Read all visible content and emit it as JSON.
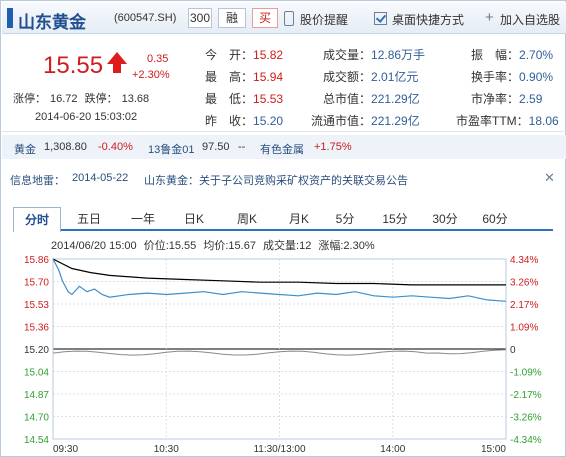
{
  "header": {
    "stock_name": "山东黄金",
    "stock_code": "(600547.SH)",
    "btn_300": "300",
    "btn_rong": "融",
    "btn_mai": "买",
    "price_alert": "股价提醒",
    "desktop_shortcut": "桌面快捷方式",
    "add_watchlist": "加入自选股",
    "plus_glyph": "+"
  },
  "quote": {
    "price": "15.55",
    "change": "0.35",
    "change_pct": "+2.30%",
    "limit_up_label": "涨停：",
    "limit_up": "16.72",
    "limit_down_label": "跌停：",
    "limit_down": "13.68",
    "time": "2014-06-20 15:03:02",
    "fields": [
      {
        "label": "今　开：",
        "value": "15.82",
        "color": "red"
      },
      {
        "label": "最　高：",
        "value": "15.94",
        "color": "red"
      },
      {
        "label": "最　低：",
        "value": "15.53",
        "color": "red"
      },
      {
        "label": "昨　收：",
        "value": "15.20",
        "color": "blue"
      },
      {
        "label": "成交量：",
        "value": "12.86万手",
        "color": "blue"
      },
      {
        "label": "成交额：",
        "value": "2.01亿元",
        "color": "blue"
      },
      {
        "label": "总市值：",
        "value": "221.29亿",
        "color": "blue"
      },
      {
        "label": "流通市值：",
        "value": "221.29亿",
        "color": "blue"
      },
      {
        "label": "振　幅：",
        "value": "2.70%",
        "color": "blue"
      },
      {
        "label": "换手率：",
        "value": "0.90%",
        "color": "blue"
      },
      {
        "label": "市净率：",
        "value": "2.59",
        "color": "blue"
      },
      {
        "label": "市盈率TTM：",
        "value": "18.06",
        "color": "blue"
      }
    ]
  },
  "sector": {
    "gold_label": "黄金",
    "gold_price": "1,308.80",
    "gold_change": "-0.40%",
    "futures_label": "13鲁金01",
    "futures_price": "97.50",
    "futures_change": "--",
    "metal_label": "有色金属",
    "metal_change": "+1.75%"
  },
  "news": {
    "label": "信息地雷：",
    "date": "2014-05-22",
    "text": "山东黄金：关于子公司竞购采矿权资产的关联交易公告",
    "close_glyph": "✕"
  },
  "tabs": [
    "分时",
    "五日",
    "一年",
    "日K",
    "周K",
    "月K",
    "5分",
    "15分",
    "30分",
    "60分"
  ],
  "chart_info": {
    "datetime": "2014/06/20 15:00",
    "price": "价位:15.55",
    "avg": "均价:15.67",
    "volume": "成交量:12",
    "change": "涨幅:2.30%"
  },
  "colors": {
    "price_line": "#3a8fd0",
    "avg_line": "#000000",
    "volume_line": "#888888",
    "up": "#d01c1c",
    "down": "#2fa02f"
  },
  "chart_data": {
    "type": "line",
    "title": "",
    "x_labels": [
      "09:30",
      "10:30",
      "11:30/13:00",
      "14:00",
      "15:00"
    ],
    "y_left_ticks": [
      "15.86",
      "15.70",
      "15.53",
      "15.36",
      "15.20",
      "15.04",
      "14.87",
      "14.70",
      "14.54"
    ],
    "y_right_ticks": [
      "4.34%",
      "3.26%",
      "2.17%",
      "1.09%",
      "0",
      "-1.09%",
      "-2.17%",
      "-3.26%",
      "-4.34%"
    ],
    "ylim": [
      14.54,
      15.86
    ],
    "series": [
      {
        "name": "价位",
        "x": [
          0,
          3,
          5,
          8,
          10,
          14,
          18,
          22,
          26,
          30,
          40,
          50,
          60,
          70,
          80,
          90,
          100,
          110,
          120,
          130,
          140,
          150,
          160,
          170,
          180,
          190,
          200,
          210,
          220,
          230,
          240
        ],
        "values": [
          15.86,
          15.78,
          15.7,
          15.62,
          15.6,
          15.66,
          15.62,
          15.64,
          15.6,
          15.58,
          15.6,
          15.61,
          15.6,
          15.61,
          15.62,
          15.6,
          15.62,
          15.61,
          15.6,
          15.59,
          15.61,
          15.6,
          15.62,
          15.59,
          15.58,
          15.59,
          15.58,
          15.57,
          15.59,
          15.56,
          15.55
        ]
      },
      {
        "name": "均价",
        "x": [
          0,
          10,
          20,
          30,
          50,
          70,
          90,
          110,
          130,
          150,
          170,
          190,
          210,
          240
        ],
        "values": [
          15.86,
          15.79,
          15.76,
          15.74,
          15.72,
          15.71,
          15.7,
          15.69,
          15.69,
          15.68,
          15.68,
          15.67,
          15.67,
          15.67
        ]
      }
    ],
    "grid": true
  }
}
